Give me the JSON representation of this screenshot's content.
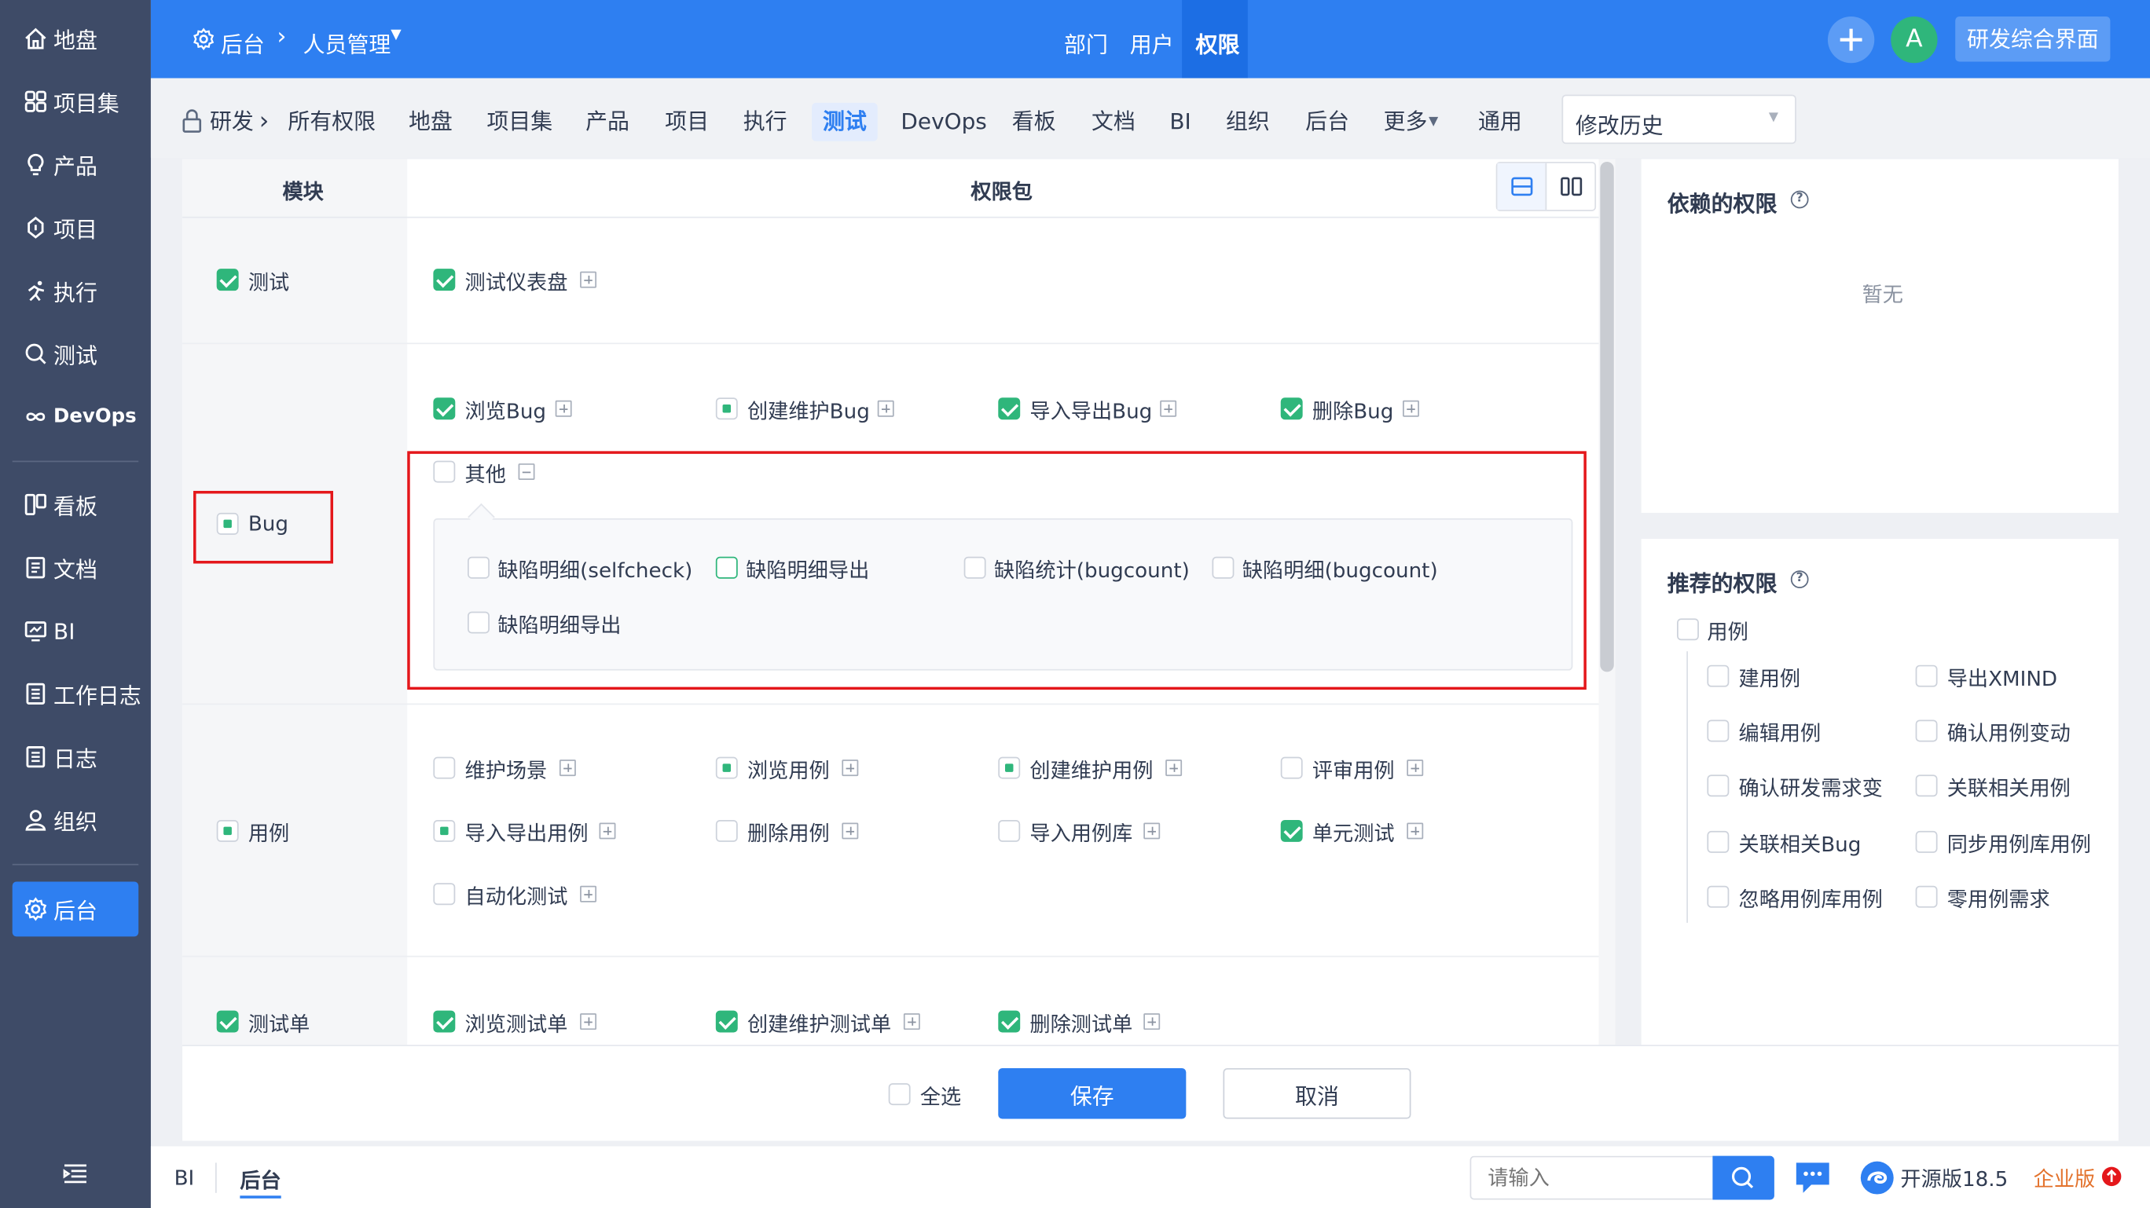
{
  "sidebar": {
    "items": [
      {
        "label": "地盘",
        "icon": "home-icon"
      },
      {
        "label": "项目集",
        "icon": "grid-icon"
      },
      {
        "label": "产品",
        "icon": "bulb-icon"
      },
      {
        "label": "项目",
        "icon": "project-icon"
      },
      {
        "label": "执行",
        "icon": "run-icon"
      },
      {
        "label": "测试",
        "icon": "search-icon"
      },
      {
        "label": "DevOps",
        "icon": "infinity-icon"
      },
      {
        "label": "看板",
        "icon": "kanban-icon"
      },
      {
        "label": "文档",
        "icon": "document-icon"
      },
      {
        "label": "BI",
        "icon": "monitor-icon"
      },
      {
        "label": "工作日志",
        "icon": "log-icon"
      },
      {
        "label": "日志",
        "icon": "journal-icon"
      },
      {
        "label": "组织",
        "icon": "user-icon"
      },
      {
        "label": "后台",
        "icon": "gear-icon"
      }
    ],
    "active": "后台"
  },
  "header": {
    "breadcrumb_root": "后台",
    "breadcrumb_current": "人员管理",
    "tabs": [
      "部门",
      "用户",
      "权限"
    ],
    "active_tab": "权限",
    "avatar": "A",
    "workspace_button": "研发综合界面"
  },
  "subnav": {
    "prefix": "研发",
    "items": [
      "所有权限",
      "地盘",
      "项目集",
      "产品",
      "项目",
      "执行",
      "测试",
      "DevOps",
      "看板",
      "文档",
      "BI",
      "组织",
      "后台",
      "更多",
      "通用"
    ],
    "active": "测试",
    "history_select": "修改历史"
  },
  "table": {
    "col_module": "模块",
    "col_package": "权限包",
    "modules": {
      "test": "测试",
      "bug": "Bug",
      "case": "用例",
      "testtask": "测试单"
    },
    "packages": {
      "p1": "测试仪表盘",
      "p2": "浏览Bug",
      "p3": "创建维护Bug",
      "p4": "导入导出Bug",
      "p5": "删除Bug",
      "p6": "其他",
      "p7": "维护场景",
      "p8": "浏览用例",
      "p9": "创建维护用例",
      "p10": "评审用例",
      "p11": "导入导出用例",
      "p12": "删除用例",
      "p13": "导入用例库",
      "p14": "单元测试",
      "p15": "自动化测试",
      "p16": "浏览测试单",
      "p17": "创建维护测试单",
      "p18": "删除测试单"
    },
    "other_items": [
      "缺陷明细(selfcheck)",
      "缺陷明细导出",
      "缺陷统计(bugcount)",
      "缺陷明细(bugcount)",
      "缺陷明细导出"
    ]
  },
  "dependent": {
    "title": "依赖的权限",
    "empty": "暂无"
  },
  "recommended": {
    "title": "推荐的权限",
    "group": "用例",
    "items": [
      "建用例",
      "导出XMIND",
      "编辑用例",
      "确认用例变动",
      "确认研发需求变",
      "关联相关用例",
      "关联相关Bug",
      "同步用例库用例",
      "忽略用例库用例",
      "零用例需求"
    ]
  },
  "actions": {
    "select_all": "全选",
    "save": "保存",
    "cancel": "取消"
  },
  "footer": {
    "tabs": [
      "BI",
      "后台"
    ],
    "active_tab": "后台",
    "search_placeholder": "请输入",
    "version": "开源版18.5",
    "enterprise": "企业版"
  },
  "colors": {
    "primary": "#2e7ff1",
    "sidebar": "#3e4b67",
    "checked": "#2fb67b",
    "highlight_box": "#e4171b",
    "enterprise": "#e3722c"
  }
}
